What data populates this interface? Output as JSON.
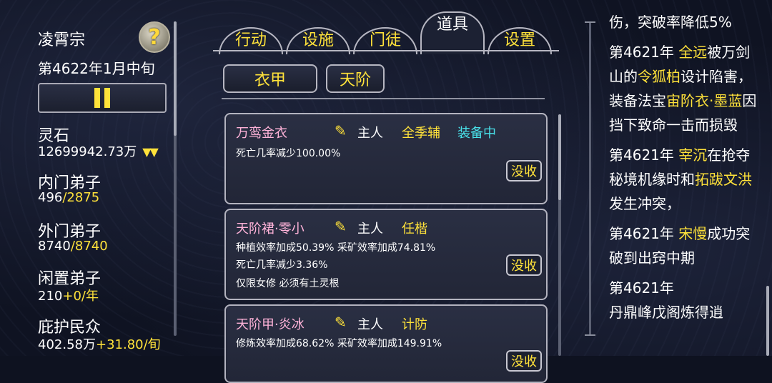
{
  "sect": {
    "name": "凌霄宗",
    "date": "第4622年1月中旬",
    "help_glyph": "?"
  },
  "stats": {
    "spirit_stone_label": "灵石",
    "spirit_stone_value": "12699942.73万",
    "spirit_stone_trend": "▼▼",
    "inner_label": "内门弟子",
    "inner_current": "496",
    "inner_max": "/2875",
    "outer_label": "外门弟子",
    "outer_current": "8740",
    "outer_max": "/8740",
    "idle_label": "闲置弟子",
    "idle_value": "210",
    "idle_rate": "+0/年",
    "protect_label": "庇护民众",
    "protect_value": "402.58万",
    "protect_rate": "+31.80/旬"
  },
  "tabs": [
    {
      "label": "行动"
    },
    {
      "label": "设施"
    },
    {
      "label": "门徒"
    },
    {
      "label": "道具"
    },
    {
      "label": "设置"
    }
  ],
  "filters": [
    {
      "label": "衣甲"
    },
    {
      "label": "天阶"
    }
  ],
  "items": [
    {
      "name": "万鸾金衣",
      "owner": "主人",
      "role": "全季辅",
      "status": "装备中",
      "desc1": "死亡几率减少100.00%",
      "desc2": "",
      "desc3": "",
      "action": "没收"
    },
    {
      "name": "天阶裙·零小",
      "owner": "主人",
      "role": "任楷",
      "status": "",
      "desc1": "种植效率加成50.39% 采矿效率加成74.81%",
      "desc2": "死亡几率减少3.36%",
      "desc3": "仅限女修 必须有土灵根",
      "action": "没收"
    },
    {
      "name": "天阶甲·炎冰",
      "owner": "主人",
      "role": "计防",
      "status": "",
      "desc1": "修炼效率加成68.62% 采矿效率加成149.91%",
      "desc2": "",
      "desc3": "",
      "action": "没收"
    }
  ],
  "log": {
    "l1": "伤，突破率降低5%",
    "e2_year": "第4621年 ",
    "e2_name1": "全远",
    "e2_t1": "被万剑山的",
    "e2_name2": "令狐柏",
    "e2_t2": "设计陷害，装备法宝",
    "e2_item": "宙阶衣·墨蓝",
    "e2_t3": "因挡下致命一击而损毁",
    "e3_year": "第4621年 ",
    "e3_name1": "宰沉",
    "e3_t1": "在抢夺秘境机缘时和",
    "e3_name2": "拓跋文洪",
    "e3_t2": "发生冲突，",
    "e4_year": "第4621年 ",
    "e4_name1": "宋慢",
    "e4_t1": "成功突破到出窍中期",
    "e5_year": "第4621年",
    "e5_t1": "丹鼎峰戊阁炼得逍"
  },
  "colors": {
    "accent": "#ffe23a",
    "name_pink": "#ffb3d9",
    "equipped_cyan": "#49e1ea"
  }
}
